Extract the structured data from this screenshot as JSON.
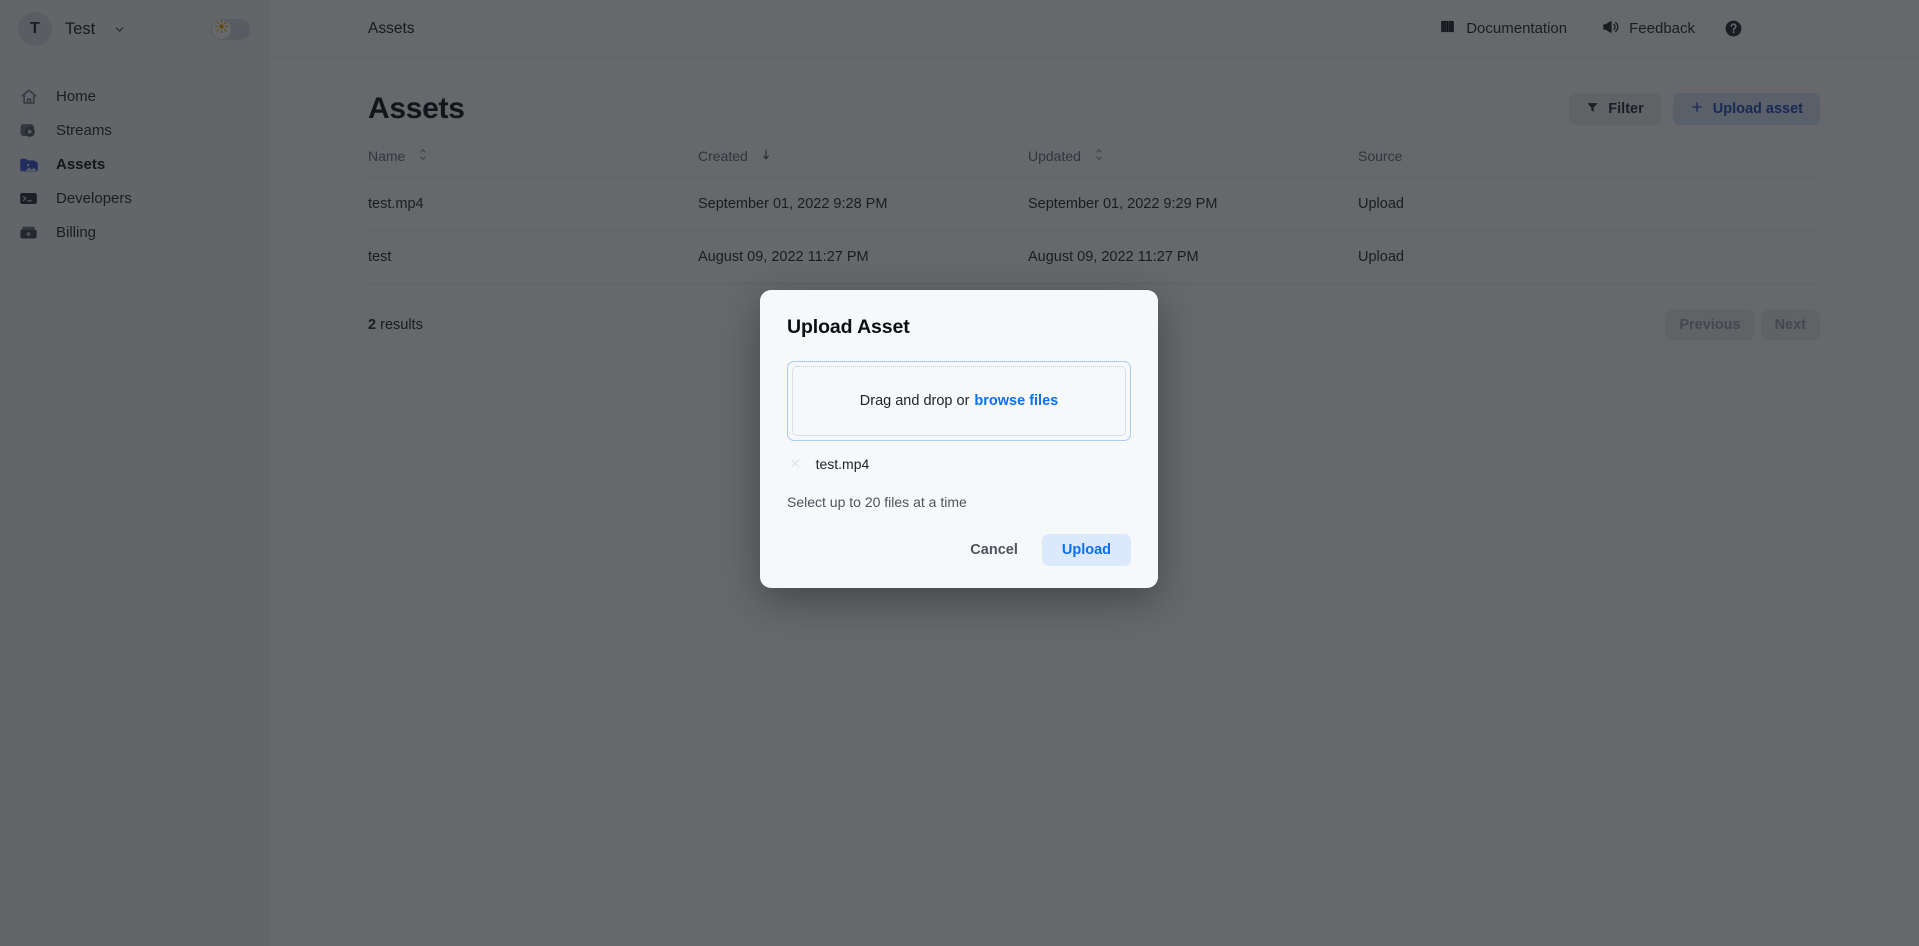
{
  "sidebar": {
    "org": {
      "avatar_initial": "T",
      "name": "Test",
      "chevron_icon": "chevron-down-icon"
    },
    "theme_toggle": {
      "icon": "sun-icon",
      "state": "light"
    },
    "items": [
      {
        "label": "Home",
        "icon": "home-icon",
        "active": false
      },
      {
        "label": "Streams",
        "icon": "play-square-icon",
        "active": false
      },
      {
        "label": "Assets",
        "icon": "image-folder-icon",
        "active": true
      },
      {
        "label": "Developers",
        "icon": "terminal-icon",
        "active": false
      },
      {
        "label": "Billing",
        "icon": "credit-card-icon",
        "active": false
      }
    ]
  },
  "topbar": {
    "breadcrumb": "Assets",
    "links": [
      {
        "label": "Documentation",
        "icon": "book-icon"
      },
      {
        "label": "Feedback",
        "icon": "megaphone-icon"
      }
    ],
    "help_icon": "help-circle-icon"
  },
  "main": {
    "title": "Assets",
    "filter_button": {
      "label": "Filter",
      "icon": "funnel-icon"
    },
    "upload_button": {
      "label": "Upload asset",
      "icon": "plus-icon"
    },
    "table": {
      "columns": [
        {
          "label": "Name",
          "sort_icon": "sort-updown-icon"
        },
        {
          "label": "Created",
          "sort_icon": "sort-down-icon"
        },
        {
          "label": "Updated",
          "sort_icon": "sort-updown-icon"
        },
        {
          "label": "Source",
          "sort_icon": ""
        }
      ],
      "rows": [
        {
          "name": "test.mp4",
          "created": "September 01, 2022 9:28 PM",
          "updated": "September 01, 2022 9:29 PM",
          "source": "Upload"
        },
        {
          "name": "test",
          "created": "August 09, 2022 11:27 PM",
          "updated": "August 09, 2022 11:27 PM",
          "source": "Upload"
        }
      ]
    },
    "results_count": "2",
    "results_label": "results",
    "pagination": {
      "previous": "Previous",
      "next": "Next"
    }
  },
  "modal": {
    "title": "Upload Asset",
    "dropzone": {
      "text": "Drag and drop or",
      "browse_label": "browse files"
    },
    "files": [
      {
        "name": "test.mp4",
        "remove_icon": "close-icon"
      }
    ],
    "hint": "Select up to 20 files at a time",
    "cancel_label": "Cancel",
    "upload_label": "Upload"
  },
  "colors": {
    "accent_blue": "#0a70f5",
    "accent_blue_soft": "#dce8fb",
    "overlay": "rgba(23,26,31,0.66)",
    "sidebar_bg": "#f7f8f9",
    "border": "#e7e9ec"
  }
}
